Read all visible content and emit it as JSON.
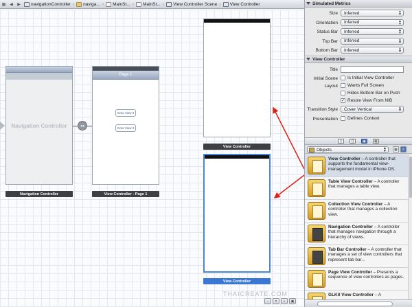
{
  "jumpbar": {
    "crumbs": [
      "navigationController",
      "naviga...",
      "MainSt...",
      "MainSt...",
      "View Controller Scene",
      "View Controller"
    ]
  },
  "canvas": {
    "nav_controller": {
      "title": "Navigation Controller",
      "label": "Navigation Controller"
    },
    "page1": {
      "navbar_title": "Page 1",
      "button1": "Goto View 2",
      "button2": "Goto View 3",
      "label": "View Controller - Page 1"
    },
    "vc_top": {
      "label": "View Controller"
    },
    "vc_bottom": {
      "label": "View Controller"
    },
    "segue_icon": "••"
  },
  "inspector": {
    "simulated_metrics": {
      "header": "Simulated Metrics",
      "rows": [
        {
          "label": "Size",
          "value": "Inferred"
        },
        {
          "label": "Orientation",
          "value": "Inferred"
        },
        {
          "label": "Status Bar",
          "value": "Inferred"
        },
        {
          "label": "Top Bar",
          "value": "Inferred"
        },
        {
          "label": "Bottom Bar",
          "value": "Inferred"
        }
      ]
    },
    "view_controller": {
      "header": "View Controller",
      "title_label": "Title",
      "title_value": "",
      "initial_scene_label": "Initial Scene",
      "is_initial_vc": "Is Initial View Controller",
      "layout_label": "Layout",
      "wants_full_screen": "Wants Full Screen",
      "hides_bottom_bar": "Hides Bottom Bar on Push",
      "resize_view": "Resize View From NIB",
      "transition_label": "Transition Style",
      "transition_value": "Cover Vertical",
      "presentation_label": "Presentation",
      "defines_context": "Defines Context",
      "checkmark": "✓"
    }
  },
  "library": {
    "objects_label": "Objects",
    "items": [
      {
        "name": "View Controller",
        "desc": " – A controller that supports the fundamental view-management model in iPhone OS."
      },
      {
        "name": "Table View Controller",
        "desc": " – A controller that manages a table view."
      },
      {
        "name": "Collection View Controller",
        "desc": " – A controller that manages a collection view."
      },
      {
        "name": "Navigation Controller",
        "desc": " – A controller that manages navigation through a hierarchy of views."
      },
      {
        "name": "Tab Bar Controller",
        "desc": " – A controller that manages a set of view controllers that represent tab bar..."
      },
      {
        "name": "Page View Controller",
        "desc": " – Presents a sequence of view controllers as pages."
      },
      {
        "name": "GLKit View Controller",
        "desc": " – A"
      }
    ]
  },
  "watermark": "THAICREATE.COM",
  "colors": {
    "accent": "#3a78d4",
    "arrow": "#e0201a"
  }
}
